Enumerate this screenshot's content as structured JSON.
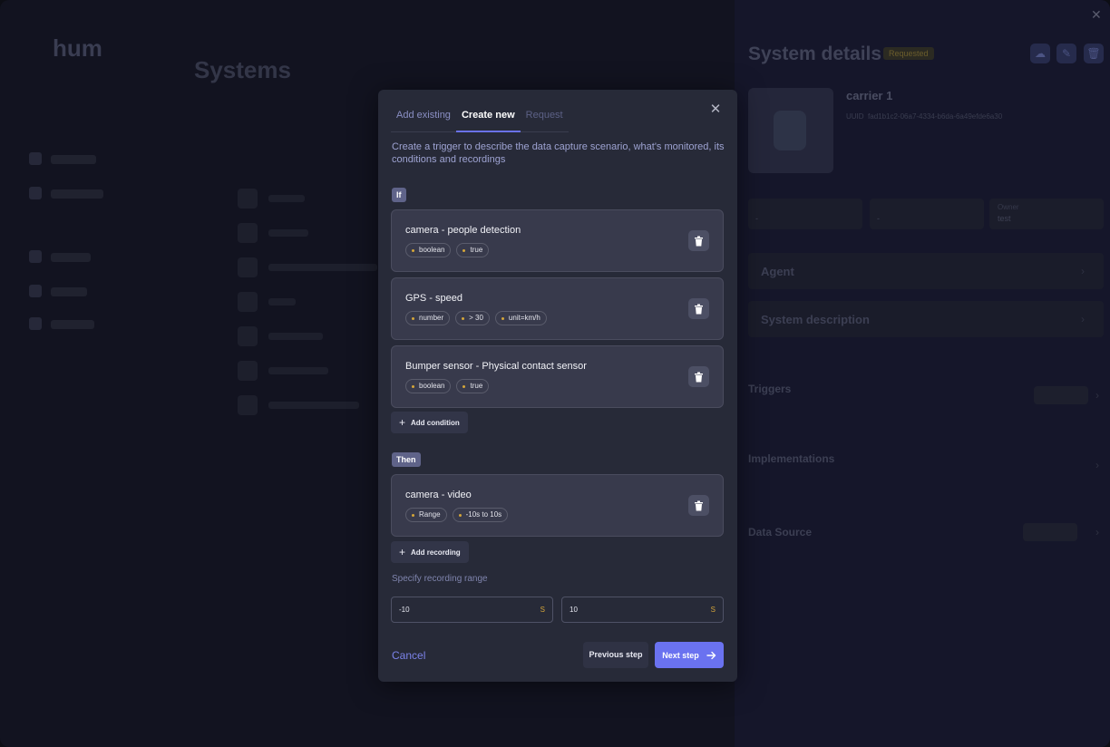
{
  "background": {
    "logo_line1": "hum",
    "logo_line2": "",
    "page_title": "Systems",
    "panel": {
      "title": "System details",
      "badge": "Requested",
      "system_name": "carrier 1",
      "uuid_label": "UUID",
      "uuid_value": "fad1b1c2-06a7-4334-b6da-6a49efde6a30",
      "stat3_label": "Owner",
      "stat3_value": "test",
      "stat1_value": "-",
      "stat2_value": "-",
      "agent_title": "Agent",
      "description_title": "System description",
      "triggers_title": "Triggers",
      "implementations_title": "Implementations",
      "datasource_title": "Data Source"
    }
  },
  "modal": {
    "tabs": [
      {
        "label": "Add existing"
      },
      {
        "label": "Create new"
      },
      {
        "label": "Request"
      }
    ],
    "description": "Create a trigger to describe the data capture scenario, what's monitored, its conditions and recordings",
    "if_label": "If",
    "conditions": [
      {
        "title": "camera - people detection",
        "chips": [
          "boolean",
          "true"
        ]
      },
      {
        "title": "GPS - speed",
        "chips": [
          "number",
          "> 30",
          "unit=km/h"
        ]
      },
      {
        "title": "Bumper sensor - Physical contact sensor",
        "chips": [
          "boolean",
          "true"
        ]
      }
    ],
    "add_condition_label": "Add condition",
    "then_label": "Then",
    "recordings": [
      {
        "title": "camera - video",
        "chips": [
          "Range",
          "-10s to 10s"
        ]
      }
    ],
    "add_recording_label": "Add recording",
    "range_label": "Specify recording range",
    "range_start": "-10",
    "range_end": "10",
    "range_unit": "S",
    "cancel_label": "Cancel",
    "prev_label": "Previous step",
    "next_label": "Next step"
  },
  "colors": {
    "accent": "#6a72f0",
    "chip_dot": "#d4a53a",
    "modal_bg": "#272a38"
  }
}
